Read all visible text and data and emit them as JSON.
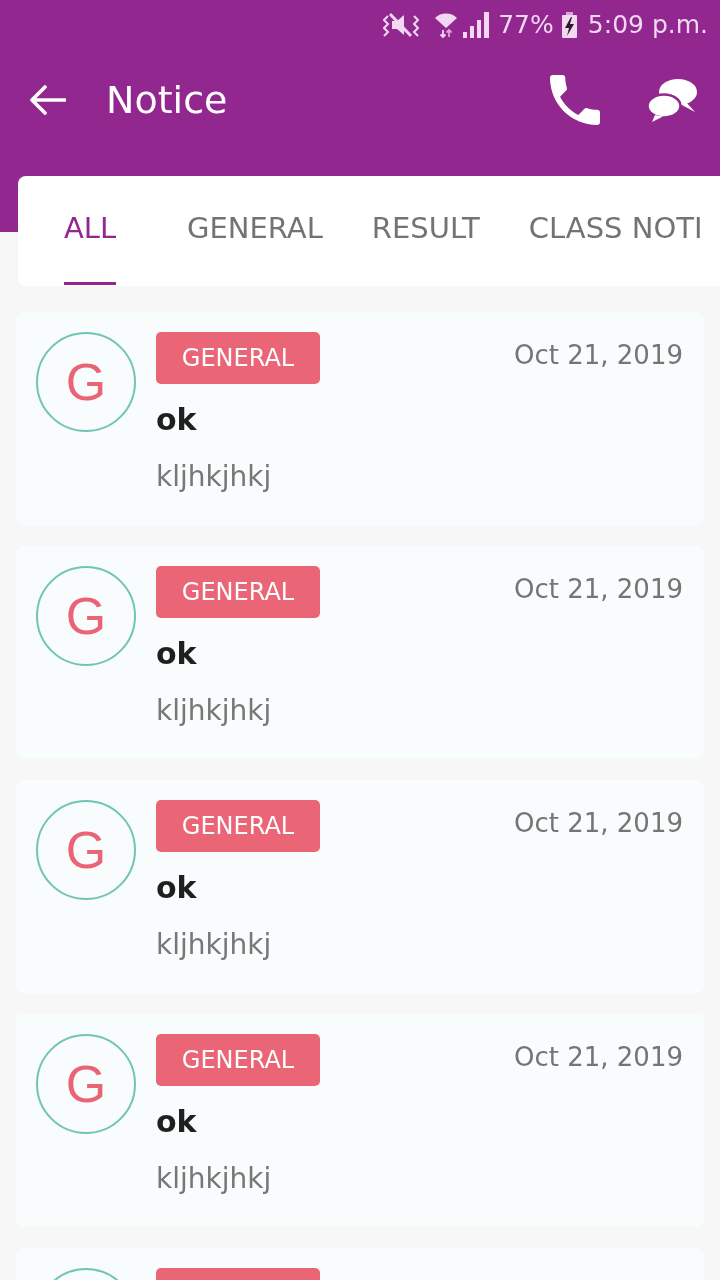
{
  "status_bar": {
    "battery_percent": "77%",
    "time": "5:09 p.m."
  },
  "app_bar": {
    "title": "Notice"
  },
  "tabs": [
    {
      "label": "ALL",
      "selected": true
    },
    {
      "label": "GENERAL",
      "selected": false
    },
    {
      "label": "RESULT",
      "selected": false
    },
    {
      "label": "CLASS NOTI",
      "selected": false
    }
  ],
  "notices": [
    {
      "avatar_letter": "G",
      "category": "GENERAL",
      "date": "Oct 21, 2019",
      "title": "ok",
      "body": "kljhkjhkj"
    },
    {
      "avatar_letter": "G",
      "category": "GENERAL",
      "date": "Oct 21, 2019",
      "title": "ok",
      "body": "kljhkjhkj"
    },
    {
      "avatar_letter": "G",
      "category": "GENERAL",
      "date": "Oct 21, 2019",
      "title": "ok",
      "body": "kljhkjhkj"
    },
    {
      "avatar_letter": "G",
      "category": "GENERAL",
      "date": "Oct 21, 2019",
      "title": "ok",
      "body": "kljhkjhkj"
    }
  ],
  "list_continues": true
}
